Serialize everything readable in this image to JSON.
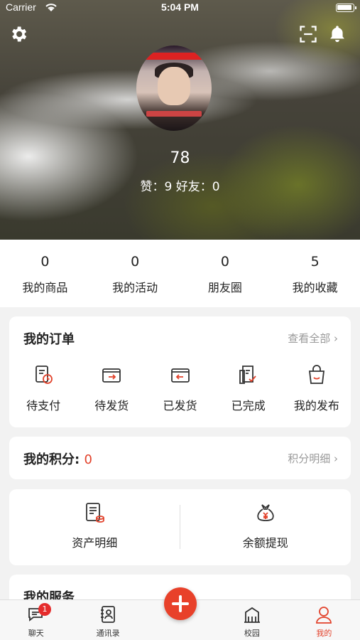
{
  "status_bar": {
    "carrier": "Carrier",
    "time": "5:04 PM"
  },
  "profile": {
    "score": "78",
    "stats_text": "赞：9 好友：0"
  },
  "counts": [
    {
      "num": "0",
      "label": "我的商品"
    },
    {
      "num": "0",
      "label": "我的活动"
    },
    {
      "num": "0",
      "label": "朋友圈"
    },
    {
      "num": "5",
      "label": "我的收藏"
    }
  ],
  "orders": {
    "title": "我的订单",
    "view_all": "查看全部 ›",
    "items": [
      {
        "label": "待支付",
        "icon": "pending-payment-icon"
      },
      {
        "label": "待发货",
        "icon": "pending-shipment-icon"
      },
      {
        "label": "已发货",
        "icon": "shipped-icon"
      },
      {
        "label": "已完成",
        "icon": "completed-icon"
      },
      {
        "label": "我的发布",
        "icon": "my-posts-icon"
      }
    ]
  },
  "points": {
    "title": "我的积分: ",
    "value": "0",
    "detail_link": "积分明细 ›"
  },
  "assets": {
    "left_label": "资产明细",
    "right_label": "余额提现"
  },
  "services": {
    "title": "我的服务"
  },
  "tabbar": {
    "items": [
      {
        "label": "聊天",
        "badge": "1"
      },
      {
        "label": "通讯录"
      },
      {
        "label": ""
      },
      {
        "label": "校园"
      },
      {
        "label": "我的"
      }
    ]
  },
  "colors": {
    "accent": "#e2422b"
  }
}
